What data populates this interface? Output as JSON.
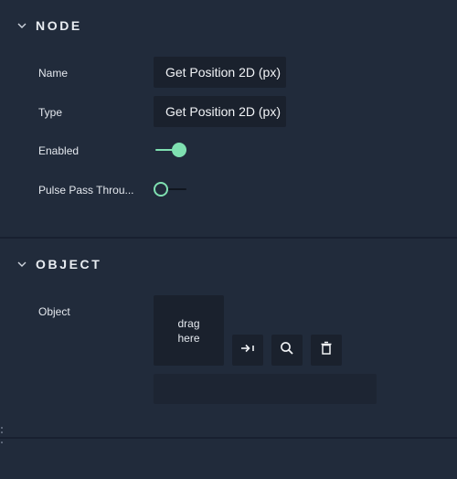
{
  "colors": {
    "background": "#212b3b",
    "field_background": "#1a212d",
    "accent": "#7fe0b1",
    "text": "#e4e8ee"
  },
  "node_section": {
    "title": "NODE",
    "expanded": true,
    "name": {
      "label": "Name",
      "value": "Get Position 2D (px)"
    },
    "type": {
      "label": "Type",
      "value": "Get Position 2D (px)"
    },
    "enabled": {
      "label": "Enabled",
      "value": true
    },
    "pulse_pass_through": {
      "label": "Pulse Pass Throu...",
      "value": false
    }
  },
  "object_section": {
    "title": "OBJECT",
    "expanded": true,
    "object": {
      "label": "Object",
      "drop_zone_line1": "drag",
      "drop_zone_line2": "here",
      "value": ""
    },
    "buttons": {
      "assign_icon": "arrow-to-bar-icon",
      "search_icon": "magnifier-icon",
      "delete_icon": "trash-icon"
    }
  }
}
